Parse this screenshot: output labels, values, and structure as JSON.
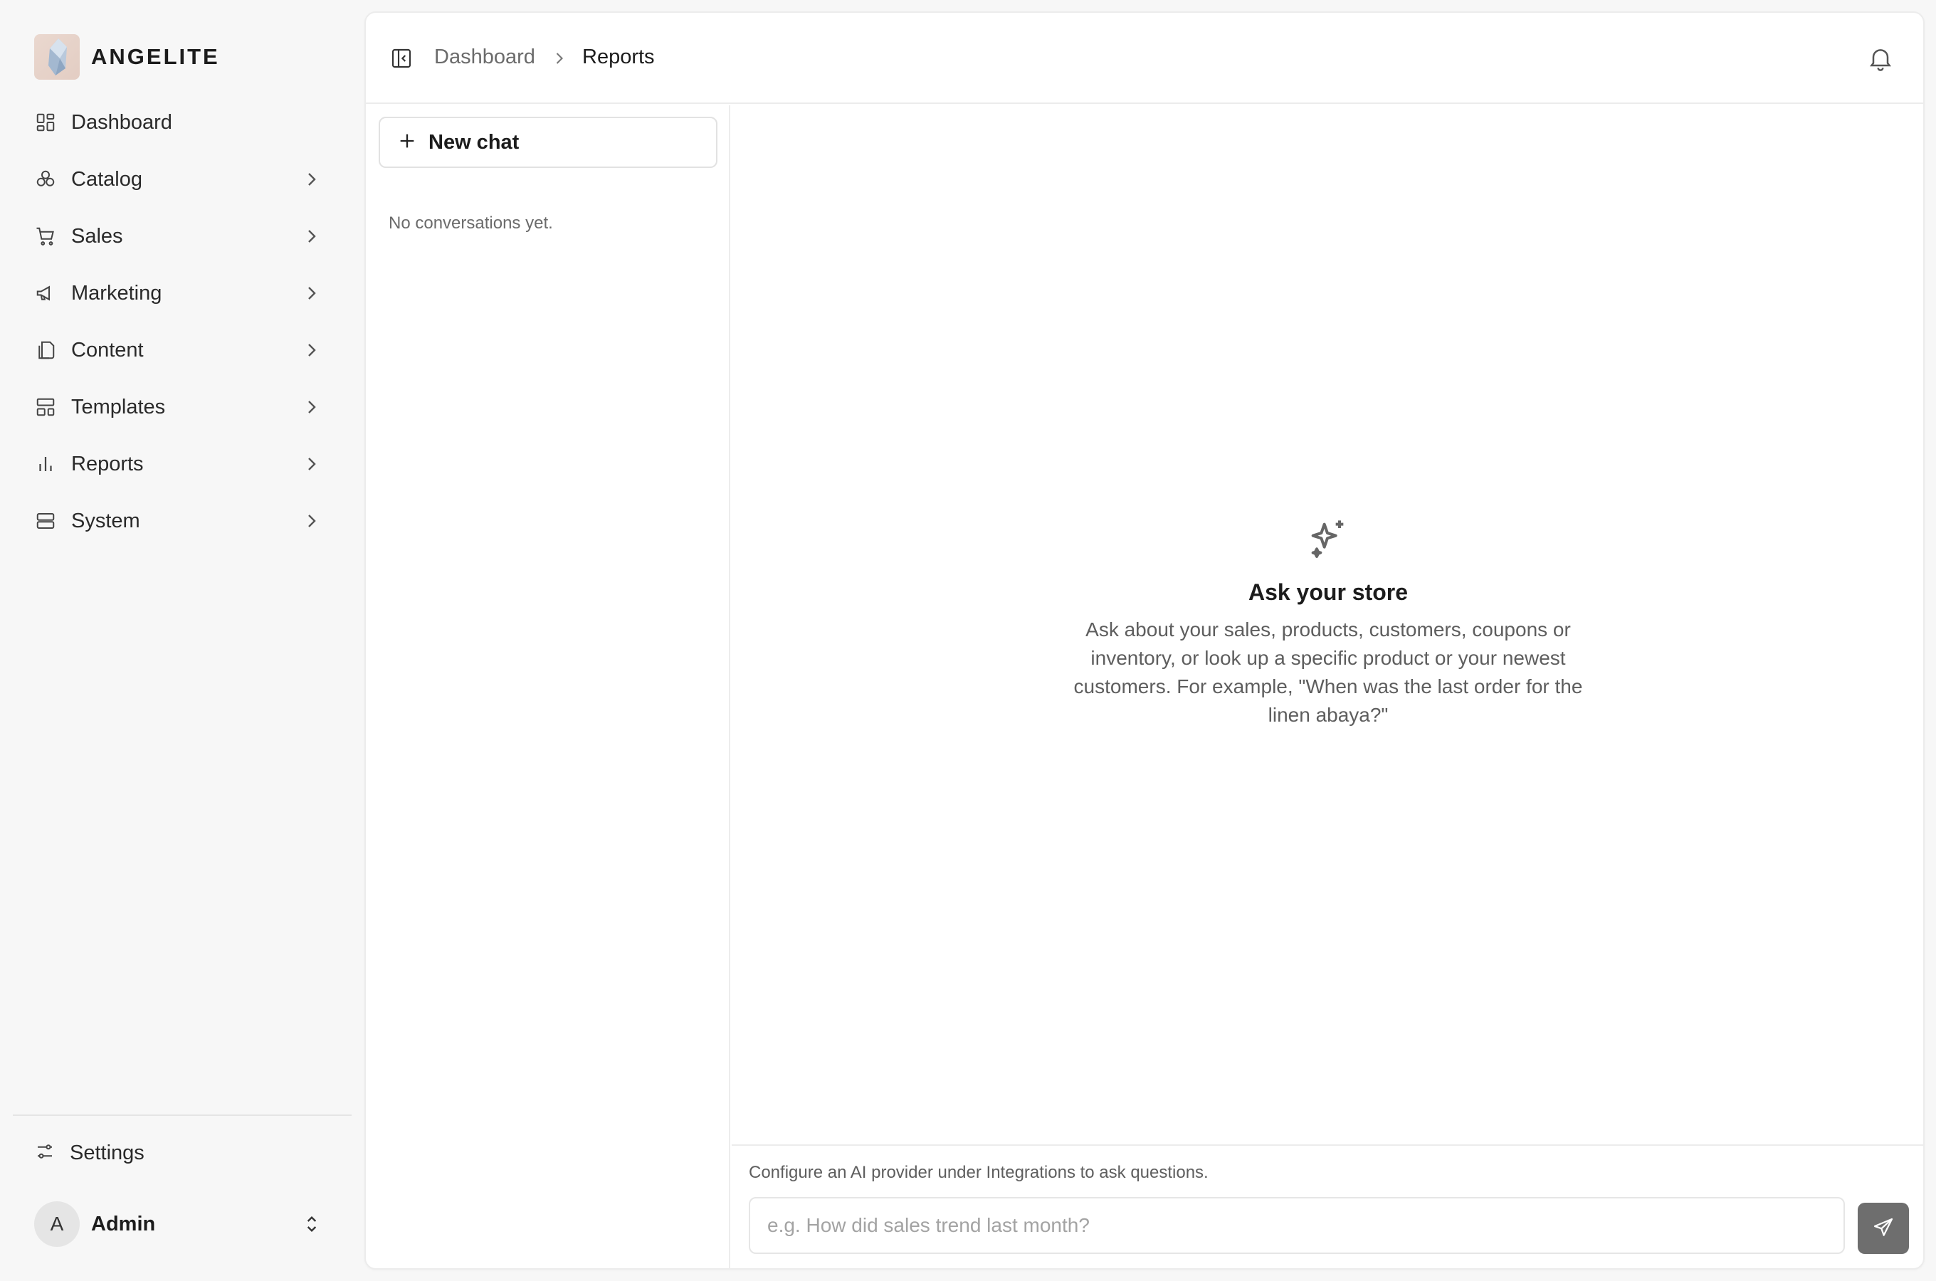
{
  "brand": {
    "name": "ANGELITE",
    "logo_icon": "crystal-logo"
  },
  "sidebar": {
    "items": [
      {
        "label": "Dashboard",
        "icon": "dashboard-icon",
        "has_submenu": false
      },
      {
        "label": "Catalog",
        "icon": "catalog-icon",
        "has_submenu": true
      },
      {
        "label": "Sales",
        "icon": "cart-icon",
        "has_submenu": true
      },
      {
        "label": "Marketing",
        "icon": "megaphone-icon",
        "has_submenu": true
      },
      {
        "label": "Content",
        "icon": "files-icon",
        "has_submenu": true
      },
      {
        "label": "Templates",
        "icon": "layout-icon",
        "has_submenu": true
      },
      {
        "label": "Reports",
        "icon": "bar-chart-icon",
        "has_submenu": true
      },
      {
        "label": "System",
        "icon": "server-icon",
        "has_submenu": true
      }
    ],
    "settings_label": "Settings",
    "user": {
      "initial": "A",
      "name": "Admin"
    }
  },
  "header": {
    "breadcrumb": [
      "Dashboard",
      "Reports"
    ]
  },
  "chat_list": {
    "new_chat_label": "New chat",
    "empty_text": "No conversations yet."
  },
  "chat": {
    "empty_title": "Ask your store",
    "empty_description": "Ask about your sales, products, customers, coupons or inventory, or look up a specific product or your newest customers. For example, \"When was the last order for the linen abaya?\"",
    "provider_note": "Configure an AI provider under Integrations to ask questions.",
    "input_placeholder": "e.g. How did sales trend last month?",
    "input_value": ""
  },
  "colors": {
    "background": "#f7f7f7",
    "panel": "#ffffff",
    "border": "#ececec",
    "send_button": "#6e6e6e",
    "text_primary": "#1c1c1c",
    "text_muted": "#6b6b6b"
  }
}
